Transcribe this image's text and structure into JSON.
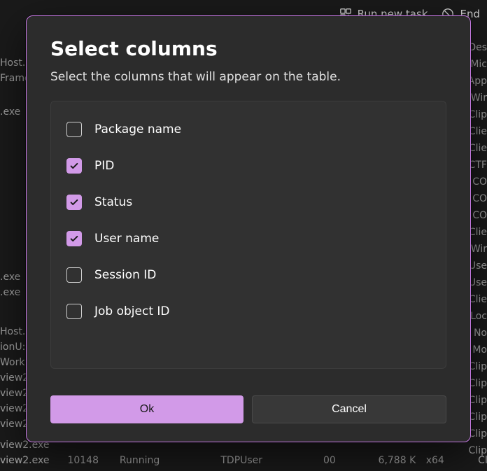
{
  "toolbar": {
    "run_task": "Run new task",
    "end": "End"
  },
  "modal": {
    "title": "Select columns",
    "description": "Select the columns that will appear on the table.",
    "ok_label": "Ok",
    "cancel_label": "Cancel",
    "options": [
      {
        "label": "Package name",
        "checked": false
      },
      {
        "label": "PID",
        "checked": true
      },
      {
        "label": "Status",
        "checked": true
      },
      {
        "label": "User name",
        "checked": true
      },
      {
        "label": "Session ID",
        "checked": false
      },
      {
        "label": "Job object ID",
        "checked": false
      }
    ]
  },
  "background": {
    "left_fragments": [
      "Host.e",
      "Frame",
      ".exe",
      ".exe",
      ".exe",
      "Host.e",
      "ionU:",
      "Work",
      "view2",
      "view2",
      "view2",
      "view2",
      "view2.exe",
      "view2.exe"
    ],
    "right_fragments": [
      "Des",
      "Mic",
      "App",
      "Wir",
      "Clip",
      "Clie",
      "Clie",
      "CTF",
      "CO",
      "CO",
      "CO",
      "Clie",
      "Wir",
      "Use",
      "Use",
      "Clie",
      "Loc",
      "No",
      "Mo",
      "Clip",
      "Clip",
      "Clip",
      "Clip",
      "Clip",
      "Clip"
    ],
    "bottom_row": {
      "name": "view2.exe",
      "pid": "10148",
      "status": "Running",
      "user": "TDPUser",
      "session": "00",
      "memory": "6,788 K",
      "arch": "x64",
      "desc": "Clip"
    }
  }
}
